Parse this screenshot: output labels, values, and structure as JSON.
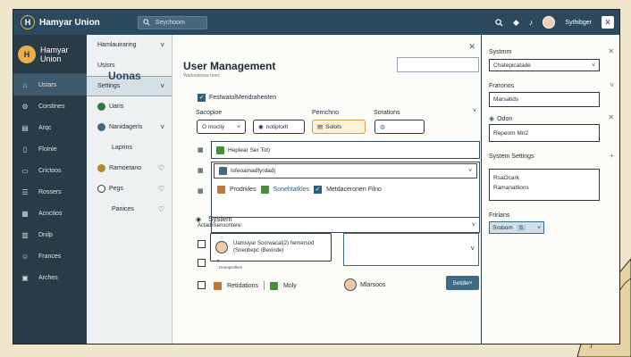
{
  "app": {
    "brand": "Hamyar Union",
    "search_placeholder": "Seychoom",
    "username": "Sythibger"
  },
  "nav": {
    "brand_line1": "Hamyar",
    "brand_line2": "Union",
    "items": [
      {
        "label": "Ustars",
        "icon": "home-icon"
      },
      {
        "label": "Corstines",
        "icon": "gear-icon"
      },
      {
        "label": "Arqc",
        "icon": "chart-icon"
      },
      {
        "label": "Floinie",
        "icon": "file-icon"
      },
      {
        "label": "Crictoos",
        "icon": "folder-icon"
      },
      {
        "label": "Rossers",
        "icon": "list-icon"
      },
      {
        "label": "Acnctios",
        "icon": "grid-icon"
      },
      {
        "label": "Dnilp",
        "icon": "chart-icon"
      },
      {
        "label": "Frances",
        "icon": "users-icon"
      },
      {
        "label": "Arches",
        "icon": "archive-icon"
      }
    ]
  },
  "submenu": {
    "title": "Uonas",
    "items": [
      {
        "label": "Hamlauiraring",
        "chev": "˅"
      },
      {
        "label": "Usisrs",
        "chev": ""
      },
      {
        "label": "Settings",
        "chev": "˅"
      },
      {
        "label": "Uaris",
        "chev": ""
      },
      {
        "label": "Nanidagerls",
        "chev": "˅"
      },
      {
        "label": "Laprins",
        "chev": ""
      },
      {
        "label": "Ramoetano",
        "chev": "♡"
      },
      {
        "label": "Pegs",
        "chev": "♡"
      },
      {
        "label": "Panices",
        "chev": "♡"
      }
    ]
  },
  "main": {
    "title": "User Management",
    "subtitle": "Wadookessa unnc",
    "checkbox_label": "FestwatolMendrahenten",
    "col_labels": [
      "Sacopioe",
      "Pernchno",
      "Sorations"
    ],
    "controls": [
      "O mocliy",
      "notiplorlt",
      "Solots"
    ],
    "rows": [
      {
        "text": "Heplear Ser Tot)"
      },
      {
        "text": "Isfeoamadfyrdad)"
      }
    ],
    "row3": [
      "Prodrkles",
      "Sonehtatkles",
      "Metdaceronen Filno"
    ],
    "system_label": "System",
    "system_sub": "Actadrisensontere:",
    "card_line1": "Uamsiyar Scorwacal(2) hemersod",
    "card_line2": "(Snenbepc (Bexinde)",
    "card_note": "Deaopsolkes",
    "bottom": [
      "Retidations",
      "Moly",
      "Mlarsoos"
    ],
    "button": "Setdle˅"
  },
  "right": {
    "section1": "Systmm",
    "field1": "Chatepicatade",
    "section2": "Fraronos",
    "field2": "Marsatids",
    "radio": "Odon",
    "field3": "Repeom Mn2",
    "section3": "System Settings",
    "field4_line1": "RsaOcark",
    "field4_line2": "Ramanatlions",
    "section4": "Fririans",
    "btn_label": "Srobom",
    "btn_value": "S"
  }
}
